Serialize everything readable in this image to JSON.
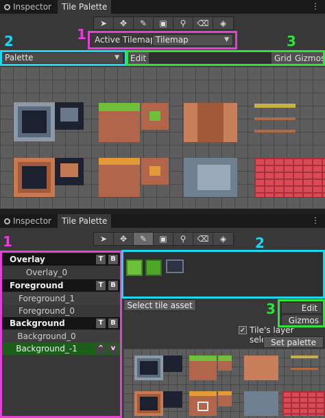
{
  "top": {
    "tabs": [
      {
        "label": "Inspector"
      },
      {
        "label": "Tile Palette"
      }
    ],
    "tools": [
      "pointer",
      "move",
      "brush",
      "box",
      "picker",
      "eraser",
      "fill"
    ],
    "active_tilemap_label": "Active Tilemap",
    "active_tilemap_value": "Tilemap",
    "palette_value": "Palette",
    "edit_label": "Edit",
    "grid_label": "Grid",
    "gizmos_label": "Gizmos",
    "annotations": [
      "1",
      "2",
      "3"
    ],
    "colors": {
      "magenta": "#e43fd6",
      "cyan": "#1fd6ee",
      "green": "#2fe33a"
    }
  },
  "bottom": {
    "tabs": [
      {
        "label": "Inspector"
      },
      {
        "label": "Tile Palette"
      }
    ],
    "annotations": [
      "1",
      "2",
      "3"
    ],
    "layers": [
      {
        "label": "Overlay",
        "kind": "header",
        "buttons": [
          "T",
          "B"
        ]
      },
      {
        "label": "Overlay_0",
        "kind": "sub"
      },
      {
        "label": "Foreground",
        "kind": "header",
        "buttons": [
          "T",
          "B"
        ]
      },
      {
        "label": "Foreground_1",
        "kind": "sub"
      },
      {
        "label": "Foreground_0",
        "kind": "sub"
      },
      {
        "label": "Background",
        "kind": "header",
        "buttons": [
          "T",
          "B"
        ]
      },
      {
        "label": "Background_0",
        "kind": "sub"
      },
      {
        "label": "Background_-1",
        "kind": "sub",
        "selected": true,
        "buttons": [
          "^",
          "v"
        ]
      }
    ],
    "select_tile_asset": "Select tile asset",
    "edit_label": "Edit",
    "gizmos_label": "Gizmos",
    "tiles_layer_selection": "Tile's layer selection",
    "tiles_layer_checked": true,
    "set_palette_icon": "Set palette icon"
  }
}
